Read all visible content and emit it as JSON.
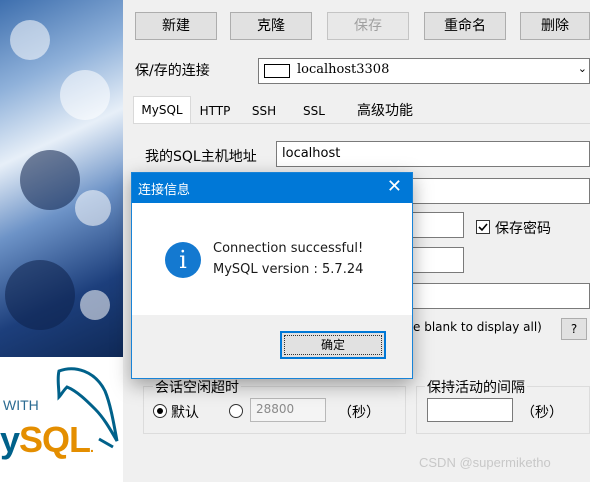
{
  "toolbar": {
    "new_label": "新建",
    "clone_label": "克隆",
    "save_label": "保存",
    "rename_label": "重命名",
    "delete_label": "删除"
  },
  "connection": {
    "label": "保/存的连接",
    "selected": "localhost3308",
    "dropdown_icon": "chevron-down-icon"
  },
  "tabs": [
    {
      "label": "MySQL",
      "active": true
    },
    {
      "label": "HTTP"
    },
    {
      "label": "SSH"
    },
    {
      "label": "SSL"
    },
    {
      "label": "高级功能"
    }
  ],
  "mysql": {
    "host_label": "我的SQL主机地址",
    "host_value": "localhost",
    "save_password_label": "保存密码",
    "databases_hint": "e blank to display all)",
    "help_label": "?"
  },
  "session": {
    "idle_title": "会话空闲超时",
    "default_label": "默认",
    "custom_value": "28800",
    "seconds_label": "（秒）",
    "keepalive_title": "保持活动的间隔",
    "keepalive_seconds_label": "（秒）"
  },
  "dialog": {
    "title": "连接信息",
    "close_glyph": "✕",
    "icon": "info-icon",
    "icon_glyph": "i",
    "message_line1": "Connection successful!",
    "message_line2": "MySQL version : 5.7.24",
    "ok_label": "确定",
    "titlebar_color": "#0078d7"
  },
  "branding": {
    "with_text": "WITH",
    "sql_y": "y",
    "sql_text": "SQL",
    "sql_dot": "."
  },
  "watermark": "CSDN @supermiketho"
}
